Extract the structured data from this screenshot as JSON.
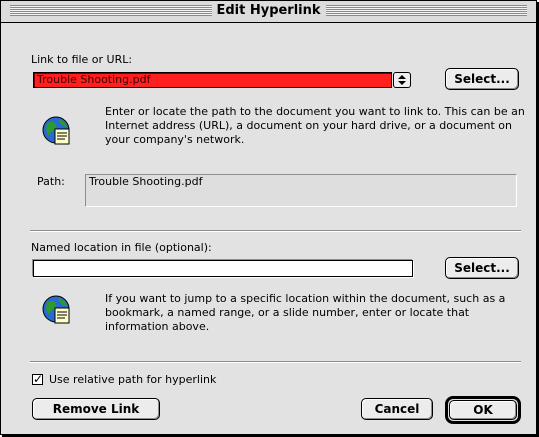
{
  "dialog": {
    "title": "Edit Hyperlink"
  },
  "link_section": {
    "label": "Link to file or URL:",
    "value": "Trouble Shooting.pdf",
    "select_label": "Select...",
    "description": "Enter or locate the path to the document you want to link to.  This can be an Internet address (URL), a document on your hard drive, or a document on your company's network.",
    "path_label": "Path:",
    "path_value": "Trouble Shooting.pdf"
  },
  "named_section": {
    "label": "Named location in file (optional):",
    "value": "",
    "select_label": "Select...",
    "description": "If you want to jump to a specific location within the document, such as a bookmark, a named range, or a slide number, enter or locate that information above."
  },
  "options": {
    "relative_path_label": "Use relative path for hyperlink",
    "relative_path_checked": true
  },
  "buttons": {
    "remove": "Remove Link",
    "cancel": "Cancel",
    "ok": "OK"
  },
  "icons": {
    "link_info": "globe-document-icon",
    "named_info": "globe-document-icon",
    "stepper": "up-down-arrows-icon",
    "checkbox": "checkmark-icon"
  },
  "colors": {
    "selected_field": "#ff1f1f",
    "dialog_background": "#e2e2e2"
  }
}
